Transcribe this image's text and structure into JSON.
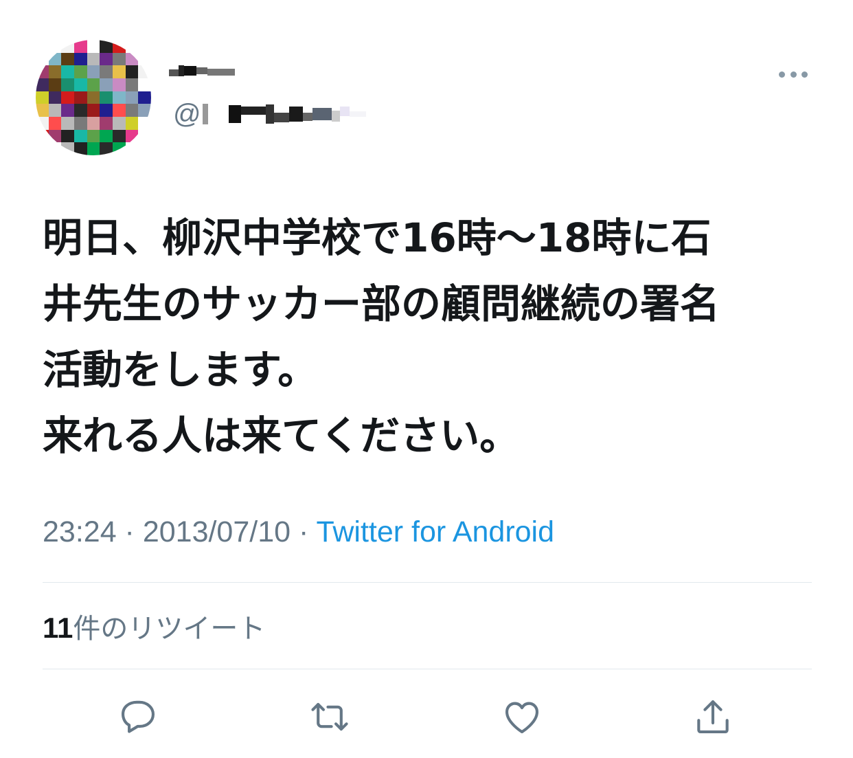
{
  "tweet": {
    "display_name": "",
    "handle_prefix": "@",
    "text_lines": [
      "明日、柳沢中学校で16時〜18時に石",
      "井先生のサッカー部の顧問継続の署名",
      "活動をします。",
      "来れる人は来てください。"
    ],
    "time": "23:24",
    "separator": " · ",
    "date": "2013/07/10",
    "source": "Twitter for Android",
    "retweet_count": "11",
    "retweet_label": "件のリツイート"
  },
  "actions": [
    {
      "icon": "reply-icon"
    },
    {
      "icon": "retweet-icon"
    },
    {
      "icon": "like-icon"
    },
    {
      "icon": "share-icon"
    }
  ],
  "colors": {
    "text": "#14171a",
    "secondary": "#657786",
    "link": "#1b95e0",
    "divider": "#e1e8ed",
    "icon": "#657786"
  }
}
